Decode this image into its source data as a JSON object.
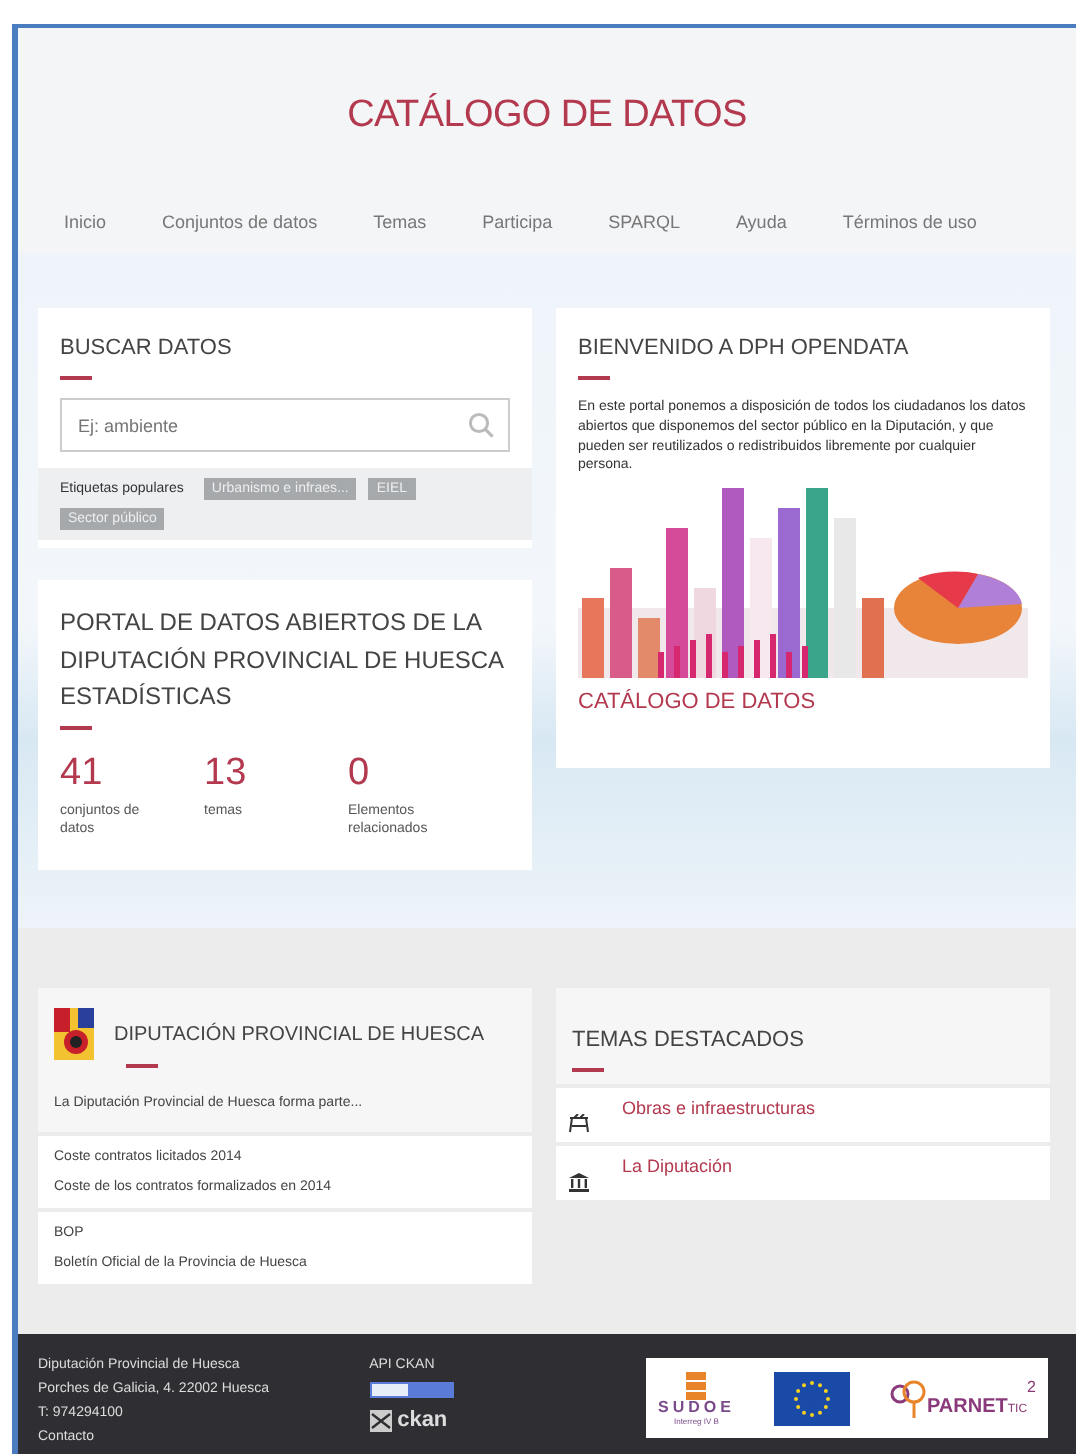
{
  "header": {
    "title": "CATÁLOGO DE DATOS"
  },
  "nav": [
    "Inicio",
    "Conjuntos de datos",
    "Temas",
    "Participa",
    "SPARQL",
    "Ayuda",
    "Términos de uso"
  ],
  "search": {
    "title": "BUSCAR DATOS",
    "placeholder": "Ej: ambiente",
    "tags_label": "Etiquetas populares",
    "tags": [
      "Urbanismo e infraes...",
      "EIEL",
      "Sector público"
    ]
  },
  "stats": {
    "title": "PORTAL DE DATOS ABIERTOS DE LA DIPUTACIÓN PROVINCIAL DE HUESCA ESTADÍSTICAS",
    "items": [
      {
        "value": "41",
        "label": "conjuntos de datos"
      },
      {
        "value": "13",
        "label": "temas"
      },
      {
        "value": "0",
        "label": "Elementos relacionados"
      }
    ]
  },
  "welcome": {
    "title": "BIENVENIDO A DPH OPENDATA",
    "text": "En este portal ponemos a disposición de todos los ciudadanos los datos abiertos que disponemos del sector público en la Diputación, y que pueden ser reutilizados o redistribuidos libremente por cualquier persona.",
    "link": "CATÁLOGO DE DATOS"
  },
  "organization": {
    "title": "DIPUTACIÓN PROVINCIAL DE HUESCA",
    "description": "La Diputación Provincial de Huesca forma parte...",
    "datasets": [
      {
        "title": "Coste contratos licitados 2014",
        "description": "Coste de los contratos formalizados en 2014"
      },
      {
        "title": "BOP",
        "description": "Boletín Oficial de la Provincia de Huesca"
      }
    ]
  },
  "topics": {
    "title": "TEMAS DESTACADOS",
    "items": [
      {
        "kind": "works",
        "label": "Obras e infraestructuras"
      },
      {
        "kind": "institution",
        "label": "La Diputación"
      }
    ]
  },
  "footer": {
    "address": [
      "Diputación Provincial de Huesca",
      "Porches de Galicia, 4. 22002 Huesca",
      "T: 974294100",
      "Contacto"
    ],
    "api": "API CKAN",
    "ckan": "ckan",
    "sudoe": "SUDOE",
    "sudoe_sub": "Interreg IV B",
    "parnet": "PARNET",
    "parnet_tic": "TIC",
    "parnet_sup": "2"
  }
}
